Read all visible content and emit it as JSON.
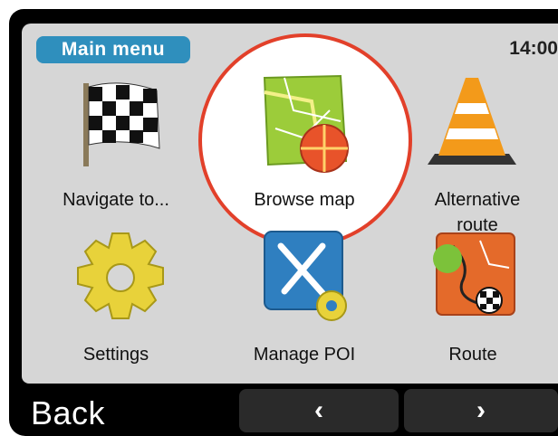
{
  "header": {
    "title": "Main menu",
    "time": "14:00"
  },
  "menu": {
    "items": [
      {
        "label": "Navigate to...",
        "icon": "checkered-flag-icon"
      },
      {
        "label": "Browse map",
        "icon": "map-icon"
      },
      {
        "label": "Alternative route",
        "icon": "traffic-cone-icon"
      },
      {
        "label": "Settings",
        "icon": "gear-icon"
      },
      {
        "label": "Manage POI",
        "icon": "fork-knife-gear-icon"
      },
      {
        "label": "Route",
        "icon": "route-map-icon"
      }
    ]
  },
  "footer": {
    "back_label": "Back",
    "prev_symbol": "‹",
    "next_symbol": "›"
  },
  "colors": {
    "title_tab": "#2f8fbd",
    "highlight": "#e2402a"
  }
}
